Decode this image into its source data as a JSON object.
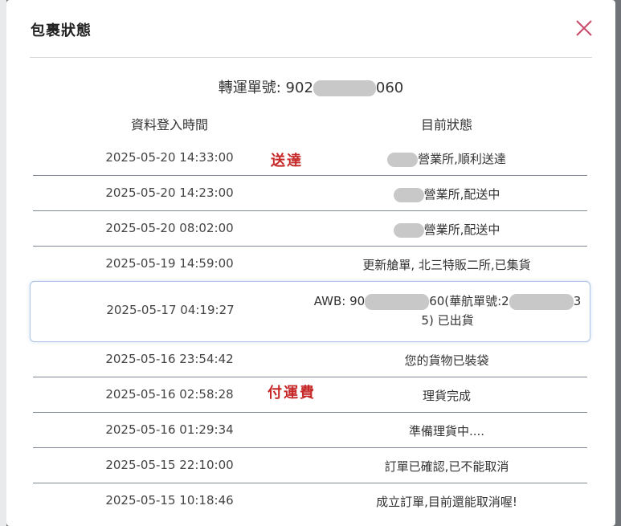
{
  "modal": {
    "title": "包裹狀態",
    "close_icon": "close-icon",
    "accent_close": "#c94a6a"
  },
  "tracking": {
    "label": "轉運單號:",
    "prefix": "902",
    "suffix": "060"
  },
  "columns": {
    "time": "資料登入時間",
    "status": "目前狀態"
  },
  "annotations": {
    "delivered": "送達",
    "pay_freight": "付運費",
    "color": "#c62828"
  },
  "rows": [
    {
      "time": "2025-05-20 14:33:00",
      "status": "營業所,順利送達"
    },
    {
      "time": "2025-05-20 14:23:00",
      "status": "營業所,配送中"
    },
    {
      "time": "2025-05-20 08:02:00",
      "status": "營業所,配送中"
    },
    {
      "time": "2025-05-19 14:59:00",
      "status": "更新艙單, 北三特販二所,已集貨"
    },
    {
      "time": "2025-05-17 04:19:27",
      "status_a": "AWB: 90",
      "status_b": "60(華航單號:2",
      "status_c": "3",
      "status_d": "5) 已出貨"
    },
    {
      "time": "2025-05-16 23:54:42",
      "status": "您的貨物已裝袋"
    },
    {
      "time": "2025-05-16 02:58:28",
      "status": "理貨完成"
    },
    {
      "time": "2025-05-16 01:29:34",
      "status": "準備理貨中...."
    },
    {
      "time": "2025-05-15 22:10:00",
      "status": "訂單已確認,已不能取消"
    },
    {
      "time": "2025-05-15 10:18:46",
      "status": "成立訂單,目前還能取消喔!"
    }
  ]
}
